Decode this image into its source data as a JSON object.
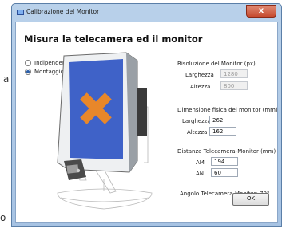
{
  "background": {
    "left_text": "a",
    "bottom_text": "o-"
  },
  "window": {
    "title": "Calibrazione del Monitor",
    "close_label": "x"
  },
  "heading": "Misura la telecamera ed il monitor",
  "mount_options": [
    {
      "label": "Indipendente",
      "selected": false
    },
    {
      "label": "Montaggio VESA",
      "selected": true
    }
  ],
  "resolution": {
    "title": "Risoluzione del Monitor (px)",
    "width_label": "Larghezza",
    "width_value": "1280",
    "height_label": "Altezza",
    "height_value": "800"
  },
  "physical_size": {
    "title": "Dimensione fisica del monitor (mm)",
    "width_label": "Larghezza",
    "width_value": "262",
    "height_label": "Altezza",
    "height_value": "162"
  },
  "distance": {
    "title": "Distanza Telecamera-Monitor (mm)",
    "am_label": "AM",
    "am_value": "194",
    "an_label": "AN",
    "an_value": "60"
  },
  "angle_text": "Angolo Telecamera-Monitor: 70°",
  "ok_label": "OK",
  "colors": {
    "screen_blue": "#3f62c8",
    "cross_orange": "#e8872a",
    "accent": "#2a5ea8"
  }
}
